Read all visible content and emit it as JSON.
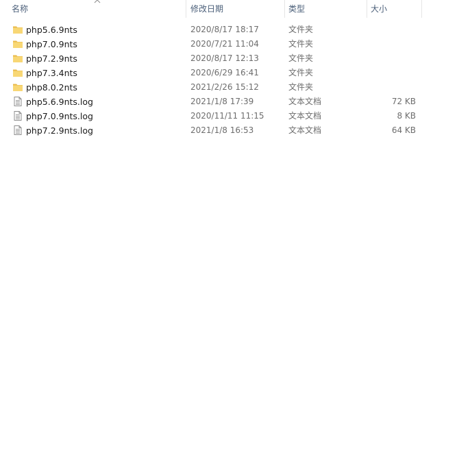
{
  "columns": {
    "name": "名称",
    "modified": "修改日期",
    "type": "类型",
    "size": "大小"
  },
  "sort_indicator": "chevron-up-icon",
  "files": [
    {
      "name": "php5.6.9nts",
      "modified": "2020/8/17 18:17",
      "type": "文件夹",
      "size": "",
      "icon": "folder-icon"
    },
    {
      "name": "php7.0.9nts",
      "modified": "2020/7/21 11:04",
      "type": "文件夹",
      "size": "",
      "icon": "folder-icon"
    },
    {
      "name": "php7.2.9nts",
      "modified": "2020/8/17 12:13",
      "type": "文件夹",
      "size": "",
      "icon": "folder-icon"
    },
    {
      "name": "php7.3.4nts",
      "modified": "2020/6/29 16:41",
      "type": "文件夹",
      "size": "",
      "icon": "folder-icon"
    },
    {
      "name": "php8.0.2nts",
      "modified": "2021/2/26 15:12",
      "type": "文件夹",
      "size": "",
      "icon": "folder-icon"
    },
    {
      "name": "php5.6.9nts.log",
      "modified": "2021/1/8 17:39",
      "type": "文本文档",
      "size": "72 KB",
      "icon": "text-file-icon"
    },
    {
      "name": "php7.0.9nts.log",
      "modified": "2020/11/11 11:15",
      "type": "文本文档",
      "size": "8 KB",
      "icon": "text-file-icon"
    },
    {
      "name": "php7.2.9nts.log",
      "modified": "2021/1/8 16:53",
      "type": "文本文档",
      "size": "64 KB",
      "icon": "text-file-icon"
    }
  ],
  "colors": {
    "header_text": "#4c607a",
    "folder": "#f8d775",
    "folder_dark": "#e9b949"
  }
}
